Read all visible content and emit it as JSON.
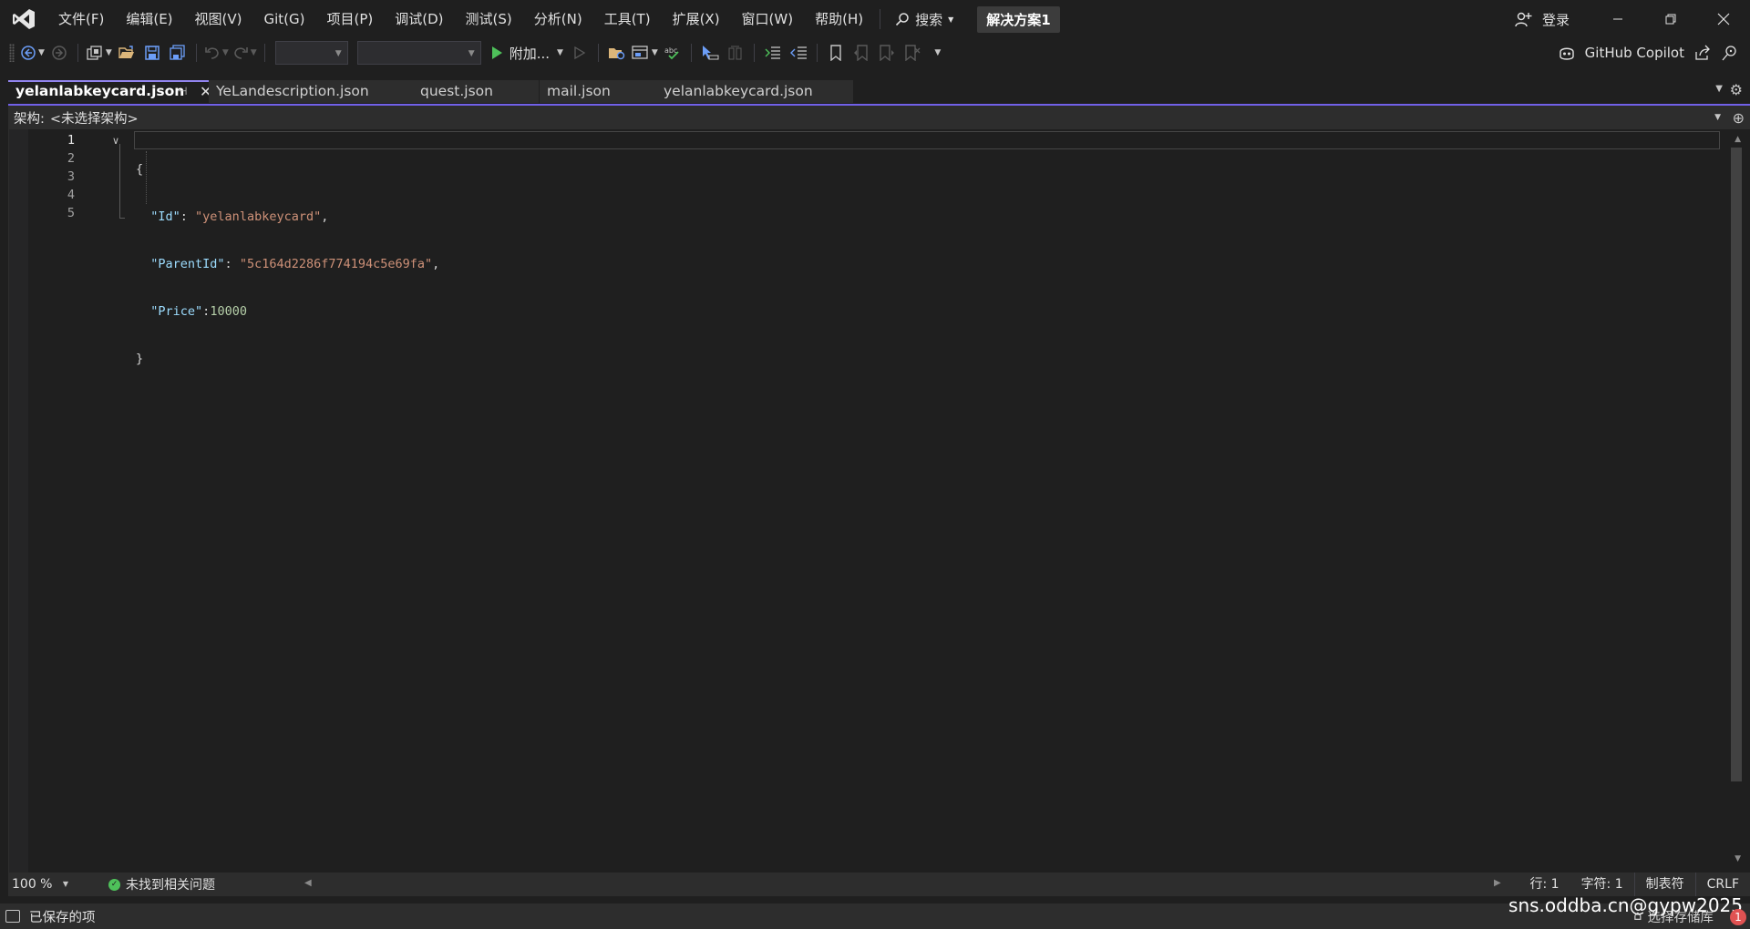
{
  "menu": {
    "items": [
      "文件(F)",
      "编辑(E)",
      "视图(V)",
      "Git(G)",
      "项目(P)",
      "调试(D)",
      "测试(S)",
      "分析(N)",
      "工具(T)",
      "扩展(X)",
      "窗口(W)",
      "帮助(H)"
    ],
    "search_label": "搜索",
    "solution_name": "解决方案1",
    "login_label": "登录"
  },
  "toolbar": {
    "attach_label": "附加...",
    "copilot_label": "GitHub Copilot"
  },
  "tabs": [
    {
      "label": "yelanlabkeycard.json",
      "active": true
    },
    {
      "label": "YeLandescription.json",
      "active": false
    },
    {
      "label": "quest.json",
      "active": false
    },
    {
      "label": "mail.json",
      "active": false
    },
    {
      "label": "yelanlabkeycard.json",
      "active": false
    }
  ],
  "schema": {
    "label": "架构:",
    "value": "<未选择架构>"
  },
  "editor": {
    "line_numbers": [
      "1",
      "2",
      "3",
      "4",
      "5"
    ],
    "current_line": 1,
    "lines": [
      {
        "text": "{"
      },
      {
        "key": "\"Id\"",
        "sep": ": ",
        "value": "\"yelanlabkeycard\"",
        "trail": ","
      },
      {
        "key": "\"ParentId\"",
        "sep": ": ",
        "value": "\"5c164d2286f774194c5e69fa\"",
        "trail": ","
      },
      {
        "key": "\"Price\"",
        "sep": ":",
        "number": "10000",
        "trail": ""
      },
      {
        "text": "}"
      }
    ]
  },
  "editor_status": {
    "zoom": "100 %",
    "issues": "未找到相关问题",
    "line": "行: 1",
    "char": "字符: 1",
    "indent": "制表符",
    "eol": "CRLF"
  },
  "statusbar": {
    "saved": "已保存的项",
    "right_text": "选择存储库",
    "watermark": "sns.oddba.cn@gypw2025",
    "notification_count": "1"
  },
  "colors": {
    "accent": "#7160e8",
    "json_key": "#9cdcfe",
    "json_string": "#ce9178",
    "json_number": "#b5cea8",
    "ok": "#4ec15a"
  }
}
